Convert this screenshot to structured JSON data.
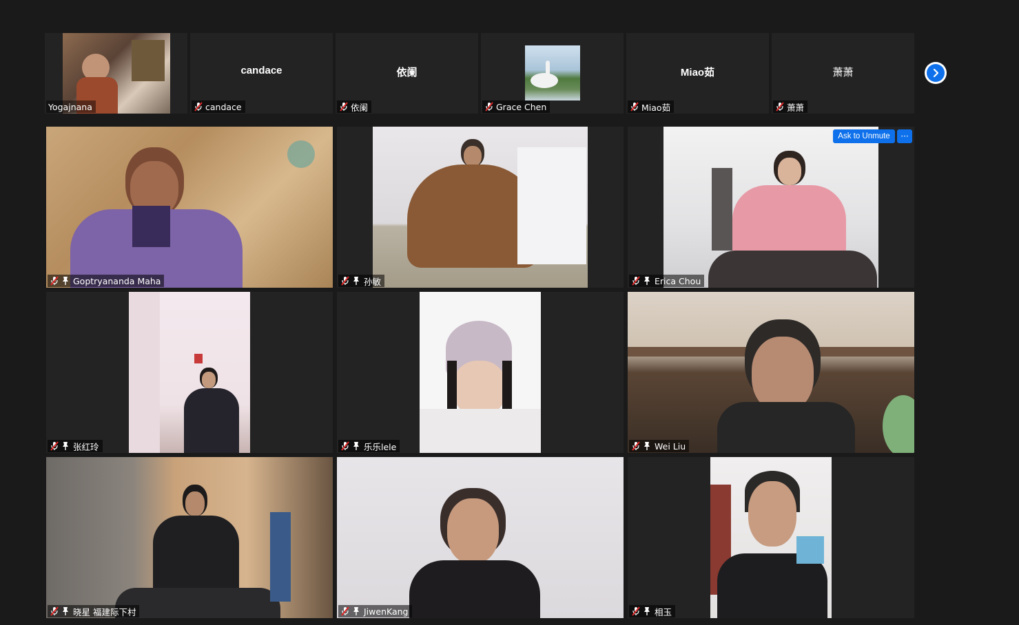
{
  "top_strip": {
    "tiles": [
      {
        "name": "Yogajnana"
      },
      {
        "name": "candace",
        "center_name": "candace"
      },
      {
        "name": "依阑",
        "center_name": "依阑"
      },
      {
        "name": "Grace Chen"
      },
      {
        "name": "Miao茹",
        "center_name": "Miao茹"
      },
      {
        "name": "萧萧",
        "center_name": "萧萧"
      }
    ],
    "next_page_icon": "chevron-right-icon"
  },
  "gallery": {
    "tiles": [
      {
        "name": "Goptryananda Maha"
      },
      {
        "name": "孙敏"
      },
      {
        "name": "Erica Chou"
      },
      {
        "name": "张红玲"
      },
      {
        "name": "乐乐lele"
      },
      {
        "name": "Wei Liu"
      },
      {
        "name": "晓星 福建际下村"
      },
      {
        "name": "JiwenKang"
      },
      {
        "name": "相玉"
      }
    ],
    "ask_to_unmute_label": "Ask to Unmute",
    "more_options_label": "···"
  },
  "colors": {
    "background": "#1a1a1a",
    "tile": "#232323",
    "accent_blue": "#0e71eb",
    "mute_red": "#e02828"
  }
}
